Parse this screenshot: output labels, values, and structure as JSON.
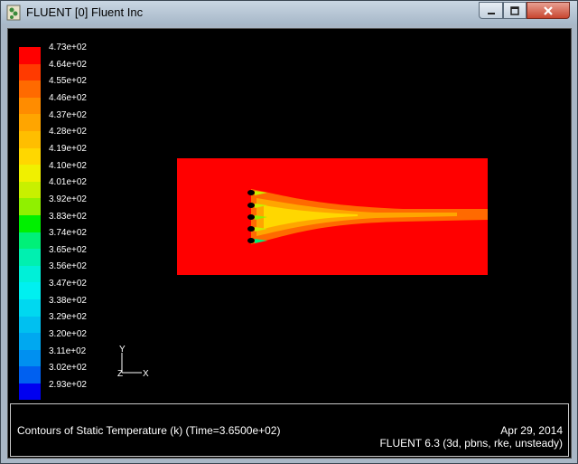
{
  "window": {
    "title": "FLUENT [0] Fluent Inc",
    "controls": [
      "minimize",
      "maximize",
      "close"
    ]
  },
  "legend": {
    "labels": [
      "4.73e+02",
      "4.64e+02",
      "4.55e+02",
      "4.46e+02",
      "4.37e+02",
      "4.28e+02",
      "4.19e+02",
      "4.10e+02",
      "4.01e+02",
      "3.92e+02",
      "3.83e+02",
      "3.74e+02",
      "3.65e+02",
      "3.56e+02",
      "3.47e+02",
      "3.38e+02",
      "3.29e+02",
      "3.20e+02",
      "3.11e+02",
      "3.02e+02",
      "2.93e+02"
    ],
    "colors": [
      "#ff0000",
      "#ff3a00",
      "#ff6a00",
      "#ff8c00",
      "#ffa500",
      "#ffbe00",
      "#ffd700",
      "#f0f000",
      "#c8f000",
      "#90f000",
      "#00f000",
      "#00f078",
      "#00f0b0",
      "#00f0d8",
      "#00f0f0",
      "#00d8f0",
      "#00c0f0",
      "#00a8f0",
      "#0090f0",
      "#0060f0",
      "#0000f0"
    ]
  },
  "axis": {
    "y_label": "Y",
    "x_label": "X",
    "z_label": "Z"
  },
  "footer": {
    "caption": "Contours of Static Temperature (k)  (Time=3.6500e+02)",
    "date": "Apr 29, 2014",
    "version": "FLUENT 6.3 (3d, pbns, rke, unsteady)"
  },
  "colors": {
    "domain_bg": "#ff0000",
    "plume_outer": "#ff6a00",
    "plume_inner": "#ffa500",
    "jet_core": "#c8f000"
  }
}
